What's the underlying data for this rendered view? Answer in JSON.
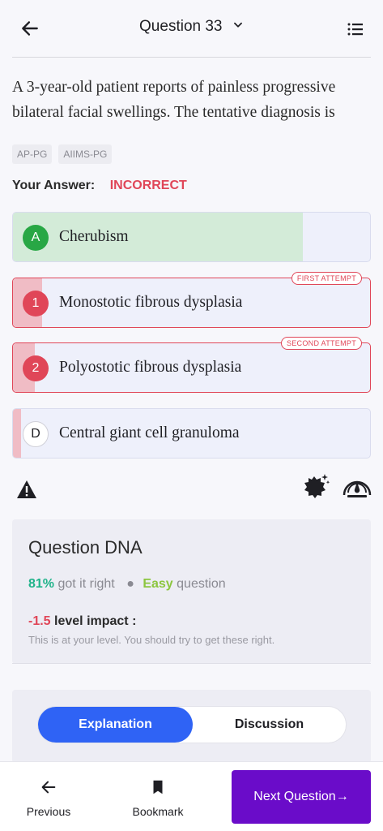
{
  "header": {
    "title": "Question 33",
    "back_icon": "back-arrow-icon",
    "dropdown_icon": "chevron-down-icon",
    "list_icon": "list-icon"
  },
  "question": {
    "text": "A 3-year-old patient reports of painless progressive bilateral facial swellings. The tentative diagnosis is",
    "tags": [
      "AP-PG",
      "AIIMS-PG"
    ]
  },
  "answer": {
    "label": "Your Answer:",
    "result": "INCORRECT"
  },
  "options": [
    {
      "badge": "A",
      "text": "Cherubism",
      "state": "correct",
      "fill_fraction": 0.81
    },
    {
      "badge": "1",
      "text": "Monostotic fibrous dysplasia",
      "state": "first-attempt",
      "attempt_label": "FIRST ATTEMPT"
    },
    {
      "badge": "2",
      "text": "Polyostotic fibrous dysplasia",
      "state": "second-attempt",
      "attempt_label": "SECOND ATTEMPT"
    },
    {
      "badge": "D",
      "text": "Central giant cell granuloma",
      "state": "neutral"
    }
  ],
  "actions": {
    "report_icon": "warning-icon",
    "burst_icon": "burst-badge-icon",
    "gauge_icon": "gauge-icon"
  },
  "dna": {
    "heading": "Question DNA",
    "pct": "81%",
    "pct_suffix": "got it right",
    "dot": "●",
    "difficulty": "Easy",
    "difficulty_suffix": "question",
    "impact_value": "-1.5",
    "impact_label": "level impact :",
    "note": "This is at your level. You should try to get these right."
  },
  "tabs": {
    "explanation": "Explanation",
    "discussion": "Discussion",
    "active": "explanation"
  },
  "bottom_nav": {
    "previous": "Previous",
    "bookmark": "Bookmark",
    "next": "Next Question",
    "next_arrow": "→"
  },
  "colors": {
    "accent_blue": "#2f63f5",
    "next_purple": "#6a0cc9",
    "correct_green": "#28a745",
    "incorrect_red": "#e04658",
    "easy_green": "#8cc63f",
    "pct_teal": "#20b38a"
  }
}
